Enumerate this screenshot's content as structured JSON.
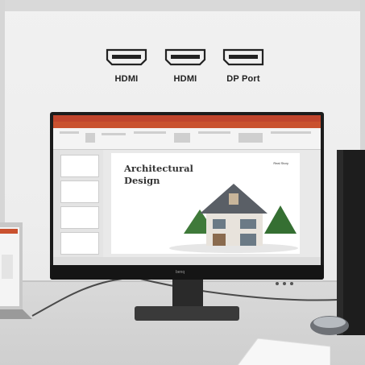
{
  "ports": [
    {
      "label": "HDMI",
      "icon": "hdmi-port-icon"
    },
    {
      "label": "HDMI",
      "icon": "hdmi-port-icon"
    },
    {
      "label": "DP Port",
      "icon": "displayport-icon"
    }
  ],
  "slide": {
    "title_line1": "Architectural",
    "title_line2": "Design",
    "tag": "Real Story"
  },
  "monitor": {
    "brand": "benq"
  },
  "colors": {
    "accent": "#c9512f",
    "bezel": "#1c1c1c"
  }
}
